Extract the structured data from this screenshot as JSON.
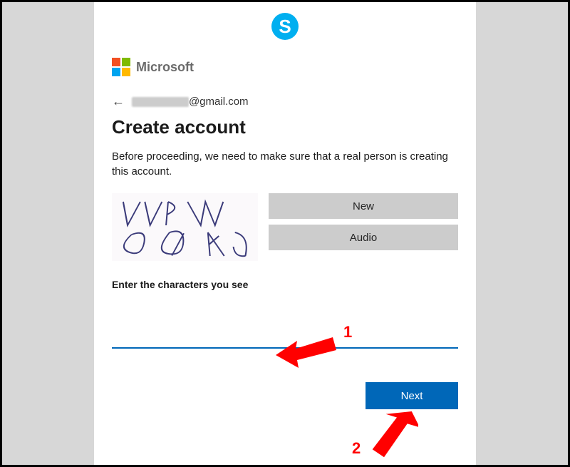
{
  "brand": {
    "microsoft_label": "Microsoft"
  },
  "identity": {
    "email_domain": "@gmail.com"
  },
  "page": {
    "heading": "Create account",
    "description": "Before proceeding, we need to make sure that a real person is creating this account."
  },
  "captcha": {
    "text": "VVPW 6QKd",
    "new_label": "New",
    "audio_label": "Audio",
    "input_label": "Enter the characters you see"
  },
  "actions": {
    "next_label": "Next"
  },
  "annotations": {
    "label1": "1",
    "label2": "2"
  }
}
